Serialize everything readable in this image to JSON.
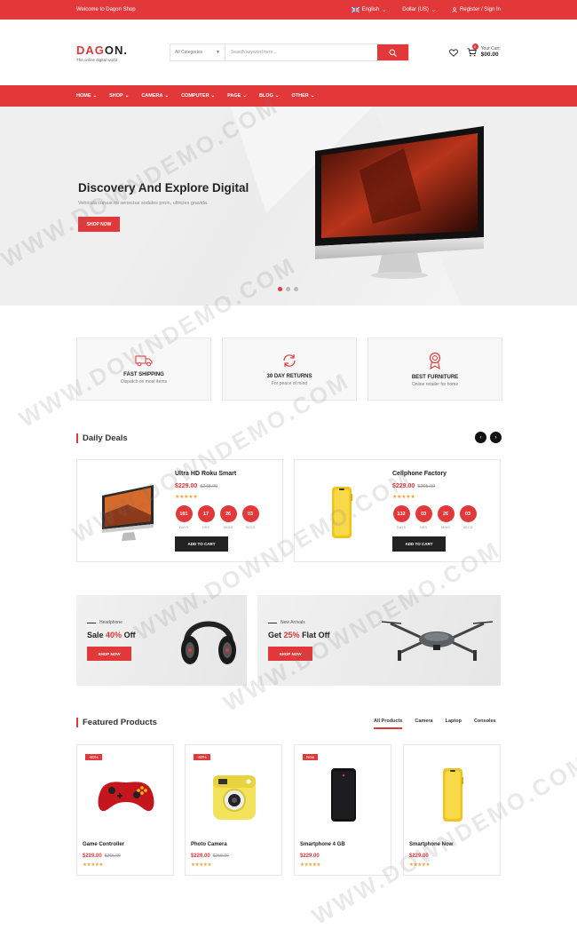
{
  "topbar": {
    "welcome": "Welcome to Dagon Shop",
    "language": "English",
    "currency": "Dollar (US)",
    "account": "Register / Sign In"
  },
  "header": {
    "logo_prefix": "DAG",
    "logo_suffix": "N.",
    "tagline": "The online digital world",
    "category_label": "All Categories",
    "search_placeholder": "Search keyword here...",
    "cart_label": "Your Cart:",
    "cart_amount": "$00.00",
    "cart_count": "0"
  },
  "nav": [
    "HOME",
    "SHOP",
    "CAMERA",
    "COMPUTER",
    "PAGE",
    "BLOG",
    "OTHER"
  ],
  "hero": {
    "title": "Discovery And Explore Digital",
    "subtitle": "Vehicula cursus mi senectus sodales proin, ultricies gravida.",
    "button": "SHOP NOW",
    "slides": 3,
    "active_slide": 1
  },
  "features": [
    {
      "title": "FAST SHIPPING",
      "desc": "Dispatch on most items",
      "icon": "truck-icon"
    },
    {
      "title": "30 DAY RETURNS",
      "desc": "For peace of mind",
      "icon": "refresh-icon"
    },
    {
      "title": "BEST FURNITURE",
      "desc": "Online retailer for home",
      "icon": "award-icon"
    }
  ],
  "deals": {
    "heading": "Daily Deals",
    "items": [
      {
        "name": "Ultra HD Roku Smart",
        "price": "$229.00",
        "old_price": "$248.00",
        "stars": "★★★★★",
        "countdown": [
          "101",
          "17",
          "26",
          "03"
        ],
        "add_label": "ADD TO CART"
      },
      {
        "name": "Cellphone Factory",
        "price": "$229.00",
        "old_price": "$265.00",
        "stars": "★★★★★",
        "countdown": [
          "132",
          "03",
          "26",
          "03"
        ],
        "add_label": "ADD TO CART"
      }
    ],
    "countdown_labels": [
      "DAYS",
      "HRS",
      "MINS",
      "SECS"
    ]
  },
  "promos": [
    {
      "small": "Headphone",
      "text_a": "Sale",
      "highlight": "40%",
      "text_b": "Off",
      "button": "SHOP NOW"
    },
    {
      "small": "New Arrivals",
      "text_a": "Get",
      "highlight": "25%",
      "text_b": "Flat Off",
      "button": "SHOP NOW"
    }
  ],
  "featured": {
    "heading": "Featured Products",
    "tabs": [
      "All Products",
      "Camera",
      "Laptop",
      "Consoles"
    ],
    "products": [
      {
        "tag": "-60%",
        "name": "Game Controller",
        "price": "$229.00",
        "old_price": "$265.00",
        "stars": "★★★★★"
      },
      {
        "tag": "-60%",
        "name": "Photo Camera",
        "price": "$229.00",
        "old_price": "$258.00",
        "stars": "★★★★★"
      },
      {
        "tag": "New",
        "name": "Smartphone 4 GB",
        "price": "$229.00",
        "old_price": "",
        "stars": "★★★★★"
      },
      {
        "tag": "",
        "name": "Smartphone Now",
        "price": "$229.00",
        "old_price": "",
        "stars": "★★★★★"
      }
    ]
  },
  "watermark": "WWW.DOWNDEMO.COM",
  "colors": {
    "accent": "#e2383a",
    "dark": "#222222",
    "star": "#f4a02b"
  }
}
